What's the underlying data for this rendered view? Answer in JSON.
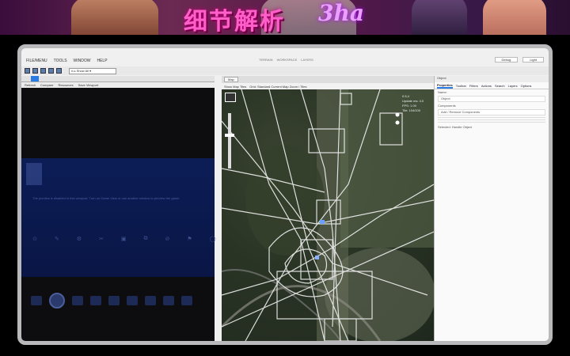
{
  "banner": {
    "title": "细节解析",
    "script": "3ha"
  },
  "menubar": {
    "items": [
      "FILE/MENU",
      "TOOLS",
      "WINDOW",
      "HELP"
    ],
    "center_items": [
      "TERRAIN",
      "WORKSPACE",
      "LAYERS"
    ],
    "right_buttons": [
      "Debug",
      "Light"
    ]
  },
  "toolbar": {
    "select_value": "rLs Show All ▾"
  },
  "left_panel": {
    "subbar": [
      "Refresh",
      "Compare",
      "Resources",
      "Save Viewport"
    ],
    "overlay_message": "The preview is disabled in this viewport. Turn on Game View or use another window to preview the game.",
    "icon_glyphs": [
      "⊙",
      "✎",
      "⚙",
      "✂",
      "▣",
      "⧉",
      "⊘",
      "⚑",
      "◯"
    ]
  },
  "map_panel": {
    "tab": "Map",
    "options": [
      "Show Map Tiles",
      "Grid: Standard Current Map Zoom / Tiles"
    ],
    "info_lines": [
      "0.5,4",
      "Update ms: 4.0",
      "FPS: 1.00",
      "Tile: 104/100"
    ]
  },
  "properties": {
    "title": "Object",
    "tabs": [
      "Properties",
      "Toolbar",
      "Filters",
      "Actions",
      "Search",
      "Layers",
      "Options"
    ],
    "rows": [
      "Name:",
      "Object",
      "Components",
      "Add / Remove Components"
    ],
    "selected_label": "Selected: Handle Object"
  }
}
